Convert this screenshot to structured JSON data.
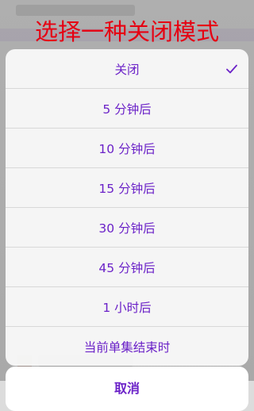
{
  "banner_text": "选择一种关闭模式",
  "options": [
    {
      "label": "关闭",
      "selected": true
    },
    {
      "label": "5 分钟后",
      "selected": false
    },
    {
      "label": "10 分钟后",
      "selected": false
    },
    {
      "label": "15 分钟后",
      "selected": false
    },
    {
      "label": "30 分钟后",
      "selected": false
    },
    {
      "label": "45 分钟后",
      "selected": false
    },
    {
      "label": "1 小时后",
      "selected": false
    },
    {
      "label": "当前单集结束时",
      "selected": false
    }
  ],
  "cancel_label": "取消",
  "colors": {
    "accent": "#6b22c8",
    "banner": "#e60012"
  }
}
